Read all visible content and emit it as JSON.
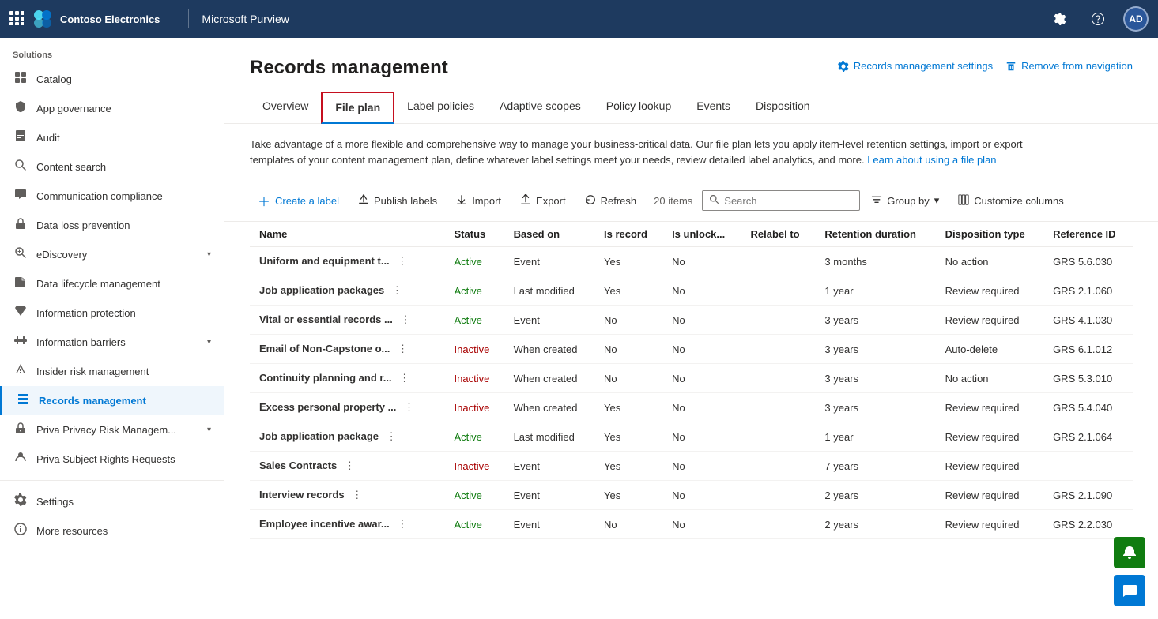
{
  "topnav": {
    "brand": "Contoso Electronics",
    "product": "Microsoft Purview",
    "avatar_initials": "AD",
    "settings_title": "Settings",
    "help_title": "Help"
  },
  "sidebar": {
    "section_label": "Solutions",
    "items": [
      {
        "id": "catalog",
        "label": "Catalog",
        "icon": "🗂",
        "has_chevron": false,
        "active": false
      },
      {
        "id": "app-governance",
        "label": "App governance",
        "icon": "🛡",
        "has_chevron": false,
        "active": false
      },
      {
        "id": "audit",
        "label": "Audit",
        "icon": "📋",
        "has_chevron": false,
        "active": false
      },
      {
        "id": "content-search",
        "label": "Content search",
        "icon": "🔍",
        "has_chevron": false,
        "active": false
      },
      {
        "id": "communication-compliance",
        "label": "Communication compliance",
        "icon": "💬",
        "has_chevron": false,
        "active": false
      },
      {
        "id": "data-loss-prevention",
        "label": "Data loss prevention",
        "icon": "🔒",
        "has_chevron": false,
        "active": false
      },
      {
        "id": "ediscovery",
        "label": "eDiscovery",
        "icon": "🔎",
        "has_chevron": true,
        "active": false
      },
      {
        "id": "data-lifecycle-management",
        "label": "Data lifecycle management",
        "icon": "📁",
        "has_chevron": false,
        "active": false
      },
      {
        "id": "information-protection",
        "label": "Information protection",
        "icon": "🏷",
        "has_chevron": false,
        "active": false
      },
      {
        "id": "information-barriers",
        "label": "Information barriers",
        "icon": "🚧",
        "has_chevron": true,
        "active": false
      },
      {
        "id": "insider-risk-management",
        "label": "Insider risk management",
        "icon": "⚠",
        "has_chevron": false,
        "active": false
      },
      {
        "id": "records-management",
        "label": "Records management",
        "icon": "📊",
        "has_chevron": false,
        "active": true
      },
      {
        "id": "priva-privacy-risk",
        "label": "Priva Privacy Risk Managem...",
        "icon": "🔐",
        "has_chevron": true,
        "active": false
      },
      {
        "id": "priva-subject-rights",
        "label": "Priva Subject Rights Requests",
        "icon": "📝",
        "has_chevron": false,
        "active": false
      }
    ],
    "bottom_items": [
      {
        "id": "settings",
        "label": "Settings",
        "icon": "⚙"
      },
      {
        "id": "more-resources",
        "label": "More resources",
        "icon": "ℹ"
      }
    ]
  },
  "content": {
    "title": "Records management",
    "header_actions": [
      {
        "id": "records-settings",
        "label": "Records management settings",
        "icon": "⚙"
      },
      {
        "id": "remove-nav",
        "label": "Remove from navigation",
        "icon": "📌"
      }
    ],
    "tabs": [
      {
        "id": "overview",
        "label": "Overview",
        "active": false
      },
      {
        "id": "file-plan",
        "label": "File plan",
        "active": true
      },
      {
        "id": "label-policies",
        "label": "Label policies",
        "active": false
      },
      {
        "id": "adaptive-scopes",
        "label": "Adaptive scopes",
        "active": false
      },
      {
        "id": "policy-lookup",
        "label": "Policy lookup",
        "active": false
      },
      {
        "id": "events",
        "label": "Events",
        "active": false
      },
      {
        "id": "disposition",
        "label": "Disposition",
        "active": false
      }
    ],
    "description": "Take advantage of a more flexible and comprehensive way to manage your business-critical data. Our file plan lets you apply item-level retention settings, import or export templates of your content management plan, define whatever label settings meet your needs, review detailed label analytics, and more.",
    "description_link": "Learn about using a file plan",
    "toolbar": {
      "create_label": "Create a label",
      "publish_labels": "Publish labels",
      "import": "Import",
      "export": "Export",
      "refresh": "Refresh",
      "item_count": "20 items",
      "search_placeholder": "Search",
      "group_by": "Group by",
      "customize_columns": "Customize columns"
    },
    "table": {
      "columns": [
        "Name",
        "Status",
        "Based on",
        "Is record",
        "Is unlock...",
        "Relabel to",
        "Retention duration",
        "Disposition type",
        "Reference ID"
      ],
      "rows": [
        {
          "name": "Uniform and equipment t...",
          "status": "Active",
          "based_on": "Event",
          "is_record": "Yes",
          "is_unlocked": "No",
          "relabel_to": "",
          "retention_duration": "3 months",
          "disposition_type": "No action",
          "reference_id": "GRS 5.6.030"
        },
        {
          "name": "Job application packages",
          "status": "Active",
          "based_on": "Last modified",
          "is_record": "Yes",
          "is_unlocked": "No",
          "relabel_to": "",
          "retention_duration": "1 year",
          "disposition_type": "Review required",
          "reference_id": "GRS 2.1.060"
        },
        {
          "name": "Vital or essential records ...",
          "status": "Active",
          "based_on": "Event",
          "is_record": "No",
          "is_unlocked": "No",
          "relabel_to": "",
          "retention_duration": "3 years",
          "disposition_type": "Review required",
          "reference_id": "GRS 4.1.030"
        },
        {
          "name": "Email of Non-Capstone o...",
          "status": "Inactive",
          "based_on": "When created",
          "is_record": "No",
          "is_unlocked": "No",
          "relabel_to": "",
          "retention_duration": "3 years",
          "disposition_type": "Auto-delete",
          "reference_id": "GRS 6.1.012"
        },
        {
          "name": "Continuity planning and r...",
          "status": "Inactive",
          "based_on": "When created",
          "is_record": "No",
          "is_unlocked": "No",
          "relabel_to": "",
          "retention_duration": "3 years",
          "disposition_type": "No action",
          "reference_id": "GRS 5.3.010"
        },
        {
          "name": "Excess personal property ...",
          "status": "Inactive",
          "based_on": "When created",
          "is_record": "Yes",
          "is_unlocked": "No",
          "relabel_to": "",
          "retention_duration": "3 years",
          "disposition_type": "Review required",
          "reference_id": "GRS 5.4.040"
        },
        {
          "name": "Job application package",
          "status": "Active",
          "based_on": "Last modified",
          "is_record": "Yes",
          "is_unlocked": "No",
          "relabel_to": "",
          "retention_duration": "1 year",
          "disposition_type": "Review required",
          "reference_id": "GRS 2.1.064"
        },
        {
          "name": "Sales Contracts",
          "status": "Inactive",
          "based_on": "Event",
          "is_record": "Yes",
          "is_unlocked": "No",
          "relabel_to": "",
          "retention_duration": "7 years",
          "disposition_type": "Review required",
          "reference_id": ""
        },
        {
          "name": "Interview records",
          "status": "Active",
          "based_on": "Event",
          "is_record": "Yes",
          "is_unlocked": "No",
          "relabel_to": "",
          "retention_duration": "2 years",
          "disposition_type": "Review required",
          "reference_id": "GRS 2.1.090"
        },
        {
          "name": "Employee incentive awar...",
          "status": "Active",
          "based_on": "Event",
          "is_record": "No",
          "is_unlocked": "No",
          "relabel_to": "",
          "retention_duration": "2 years",
          "disposition_type": "Review required",
          "reference_id": "GRS 2.2.030"
        }
      ]
    }
  },
  "fab": {
    "chat_icon": "💬",
    "notification_icon": "🔔"
  }
}
